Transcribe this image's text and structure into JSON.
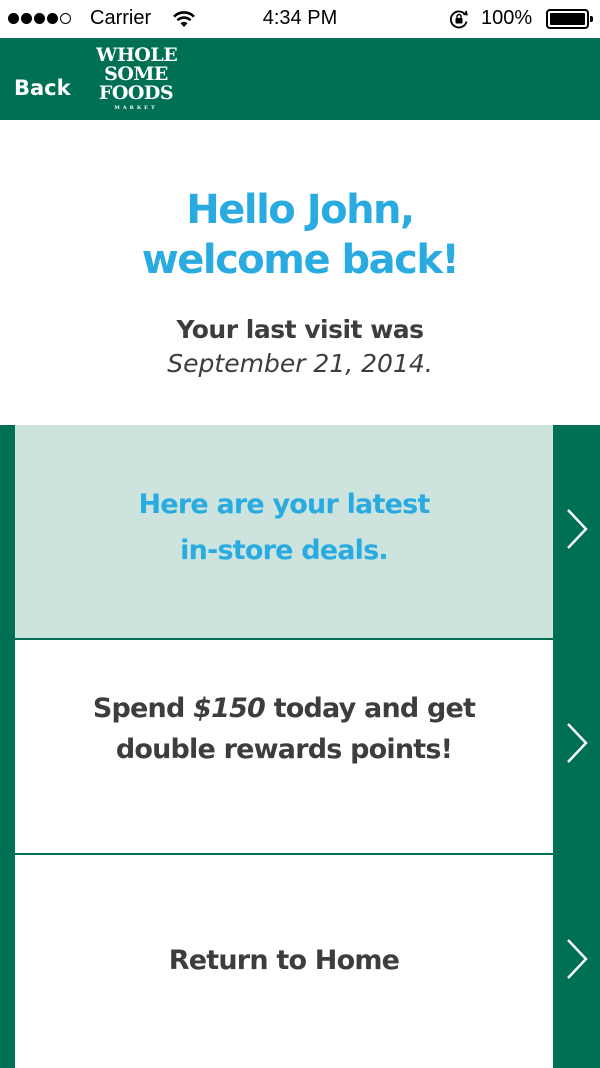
{
  "status_bar": {
    "carrier": "Carrier",
    "time": "4:34 PM",
    "battery": "100%",
    "signal_bars_filled": 4,
    "signal_bars_total": 5
  },
  "nav": {
    "back_label": "Back",
    "logo_lines": [
      "WHOLE",
      "SOME",
      "FOODS"
    ],
    "logo_subtext": "MARKET"
  },
  "welcome": {
    "greeting_line1": "Hello John,",
    "greeting_line2": "welcome back!",
    "last_visit_label": "Your last visit was",
    "last_visit_date": "September 21, 2014."
  },
  "cards": {
    "deals_line1": "Here are your latest",
    "deals_line2": "in-store deals.",
    "spend_prefix": "Spend ",
    "spend_amount": "$150",
    "spend_suffix": " today and get",
    "spend_line2": "double rewards points!",
    "home_label": "Return to Home"
  },
  "colors": {
    "brand_green": "#007054",
    "accent_blue": "#29abe2",
    "highlight_card": "#cde3de",
    "text_dark": "#3d3d3d"
  },
  "icons": [
    "wifi-icon",
    "rotation-lock-icon",
    "battery-icon",
    "chevron-right-icon"
  ]
}
